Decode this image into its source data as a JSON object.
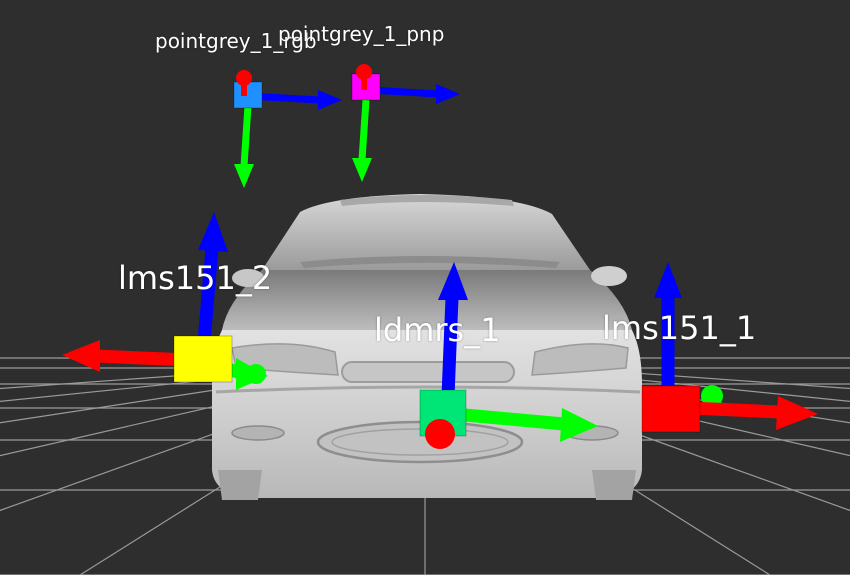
{
  "scene": {
    "background_color": "#2e2e2e",
    "grid_color": "#9a9a9a",
    "car_color": "#d6d6d6"
  },
  "axis_colors": {
    "x": "#ff0000",
    "y": "#00ff00",
    "z": "#0000ff"
  },
  "frames": {
    "pointgrey_1_rgb": {
      "label": "pointgrey_1_rgb",
      "box_color": "#1e90ff",
      "origin_color": "#ff0000"
    },
    "pointgrey_1_pnp": {
      "label": "pointgrey_1_pnp",
      "box_color": "#ff00ff",
      "origin_color": "#ff0000"
    },
    "lms151_2": {
      "label": "lms151_2",
      "box_color": "#ffff00",
      "origin_color": "#00ff00"
    },
    "ldmrs_1": {
      "label": "ldmrs_1",
      "box_color": "#00e676",
      "origin_color": "#ff0000"
    },
    "lms151_1": {
      "label": "lms151_1",
      "box_color": "#ff0000",
      "origin_color": "#00ff00"
    }
  }
}
